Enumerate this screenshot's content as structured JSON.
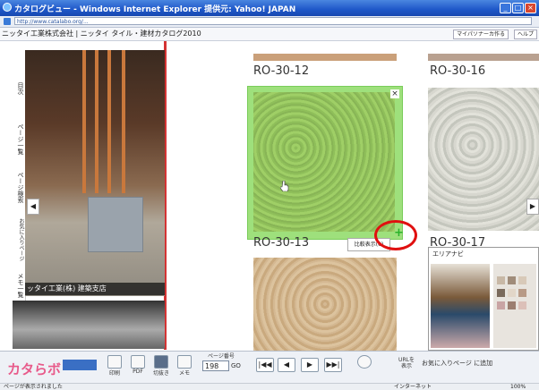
{
  "window": {
    "title": "カタログビュー - Windows Internet Explorer 提供元: Yahoo! JAPAN",
    "url": "http://www.catalabo.org/..."
  },
  "browser": {
    "tab_label": "ニッタイ工業株式会社 | ニッタイ タイル・建材カタログ2010",
    "safety_label": "マイパソナーカ作る",
    "help_label": "ヘルプ"
  },
  "left_panel": {
    "nav_tabs": [
      "目次",
      "ページ一覧",
      "ページ検索",
      "お気に入りページ",
      "メモ一覧"
    ],
    "photo_caption": "ッタイ工業(株) 建築支店",
    "prev_arrow": "◀"
  },
  "catalog": {
    "codes": {
      "top_left": "RO-30-12",
      "top_right": "RO-30-16",
      "mid_left": "RO-30-13",
      "mid_right": "RO-30-17"
    },
    "close_label": "×",
    "compare_label": "比較表示(0)",
    "add_icon_glyph": "+",
    "next_arrow": "▶",
    "area_navi_title": "エリアナビ"
  },
  "toolbar": {
    "logo": "カタらボ",
    "buttons": [
      "印刷",
      "PDF",
      "切抜き",
      "メモ"
    ],
    "page_label": "ページ番号",
    "page_value": "198",
    "go_label": "GO",
    "nav": [
      "|◀◀",
      "◀",
      "▶",
      "▶▶|"
    ],
    "url_label": "URLを\n表示",
    "fav_label": "お気に入りページ\nに追加"
  },
  "status": {
    "text": "ページが表示されました",
    "zone": "インターネット",
    "zoom": "100%"
  },
  "colors": {
    "accent_red": "#e01010",
    "selection_green": "#9ee07c",
    "ie_blue": "#1e57c8"
  }
}
